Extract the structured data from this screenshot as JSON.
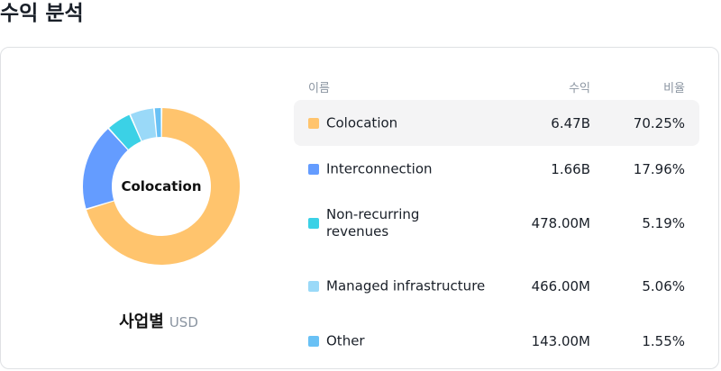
{
  "page": {
    "title": "수익 분석"
  },
  "caption": {
    "title": "사업별",
    "unit": "USD"
  },
  "donut_center": "Colocation",
  "table": {
    "headers": {
      "name": "이름",
      "revenue": "수익",
      "ratio": "비율"
    }
  },
  "colors": [
    "#ffc46d",
    "#649cff",
    "#3bd1e6",
    "#9ad9f8",
    "#69c1f5"
  ],
  "chart_data": {
    "type": "pie",
    "subtype": "donut",
    "title": "사업별",
    "unit": "USD",
    "center_label": "Colocation",
    "rows": [
      {
        "name": "Colocation",
        "revenue": "6.47B",
        "ratio": "70.25%",
        "value": 70.25,
        "color": "#ffc46d"
      },
      {
        "name": "Interconnection",
        "revenue": "1.66B",
        "ratio": "17.96%",
        "value": 17.96,
        "color": "#649cff"
      },
      {
        "name": "Non-recurring revenues",
        "revenue": "478.00M",
        "ratio": "5.19%",
        "value": 5.19,
        "color": "#3bd1e6"
      },
      {
        "name": "Managed infrastructure",
        "revenue": "466.00M",
        "ratio": "5.06%",
        "value": 5.06,
        "color": "#9ad9f8"
      },
      {
        "name": "Other",
        "revenue": "143.00M",
        "ratio": "1.55%",
        "value": 1.55,
        "color": "#69c1f5"
      }
    ]
  }
}
